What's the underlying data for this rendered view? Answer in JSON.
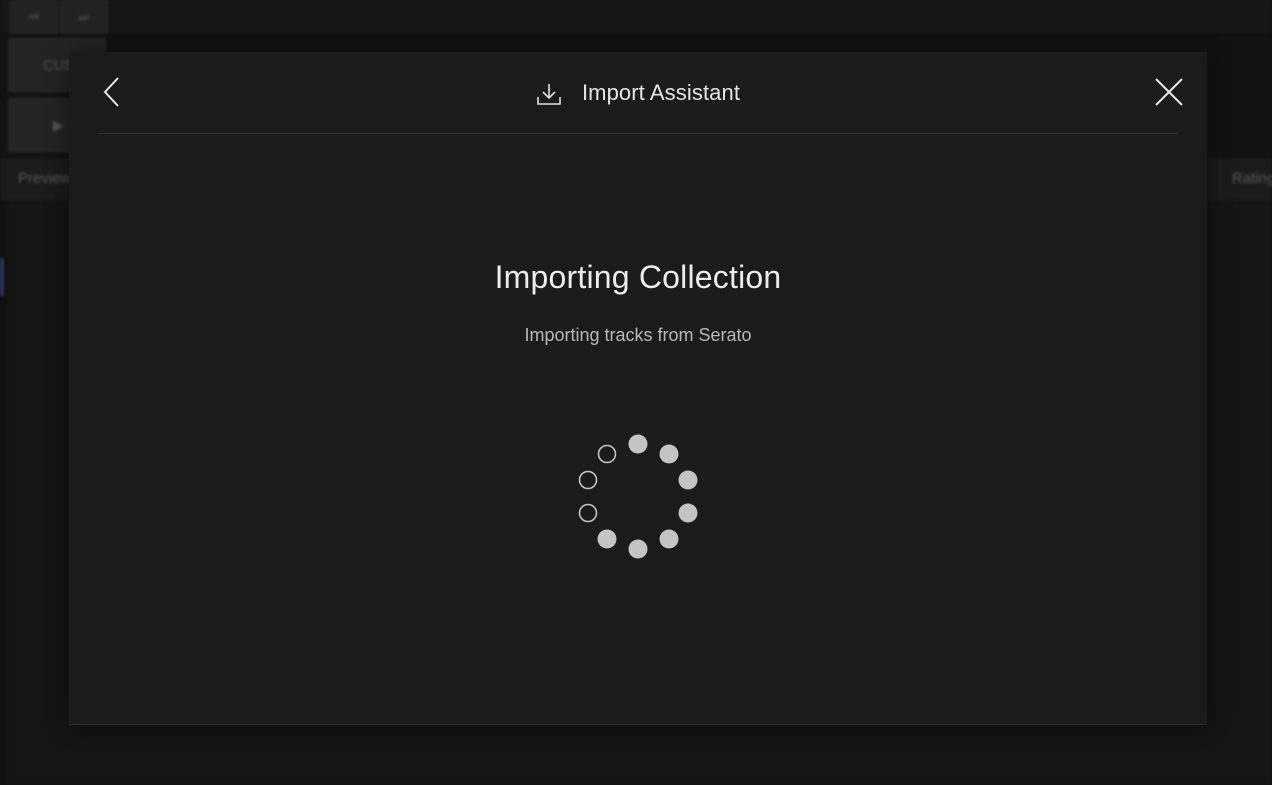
{
  "background": {
    "cue_label": "CUE",
    "columns": {
      "left": "Preview",
      "right": "Rating"
    }
  },
  "dialog": {
    "title": "Import Assistant",
    "heading": "Importing Collection",
    "status": "Importing tracks from Serato"
  },
  "icons": {
    "back": "chevron-left-icon",
    "close": "close-icon",
    "title": "download-icon",
    "spinner": "loading-spinner-icon"
  },
  "colors": {
    "modal_bg": "#1b1b1b",
    "text_primary": "#ececec",
    "text_secondary": "#b8b8b8",
    "spinner_dot": "#c4c4c4"
  }
}
